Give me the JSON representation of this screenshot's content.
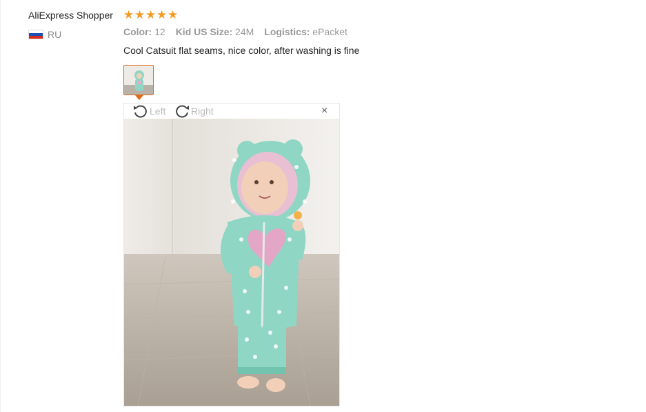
{
  "review": {
    "user_name": "AliExpress Shopper",
    "country_code": "RU",
    "rating": 5,
    "attributes": [
      {
        "label": "Color:",
        "value": "12"
      },
      {
        "label": "Kid US Size:",
        "value": "24M"
      },
      {
        "label": "Logistics:",
        "value": "ePacket"
      }
    ],
    "comment": "Cool Catsuit flat seams, nice color, after washing is fine"
  },
  "viewer": {
    "rotate_left_label": "Left",
    "rotate_right_label": "Right",
    "close_label": "×"
  },
  "colors": {
    "star": "#f39a1f",
    "thumb_border": "#e26b1a",
    "flag": [
      "#ffffff",
      "#1e4fb3",
      "#d52b1e"
    ]
  },
  "icons": [
    "star-icon",
    "rotate-left-icon",
    "rotate-right-icon",
    "close-icon",
    "russia-flag-icon"
  ]
}
